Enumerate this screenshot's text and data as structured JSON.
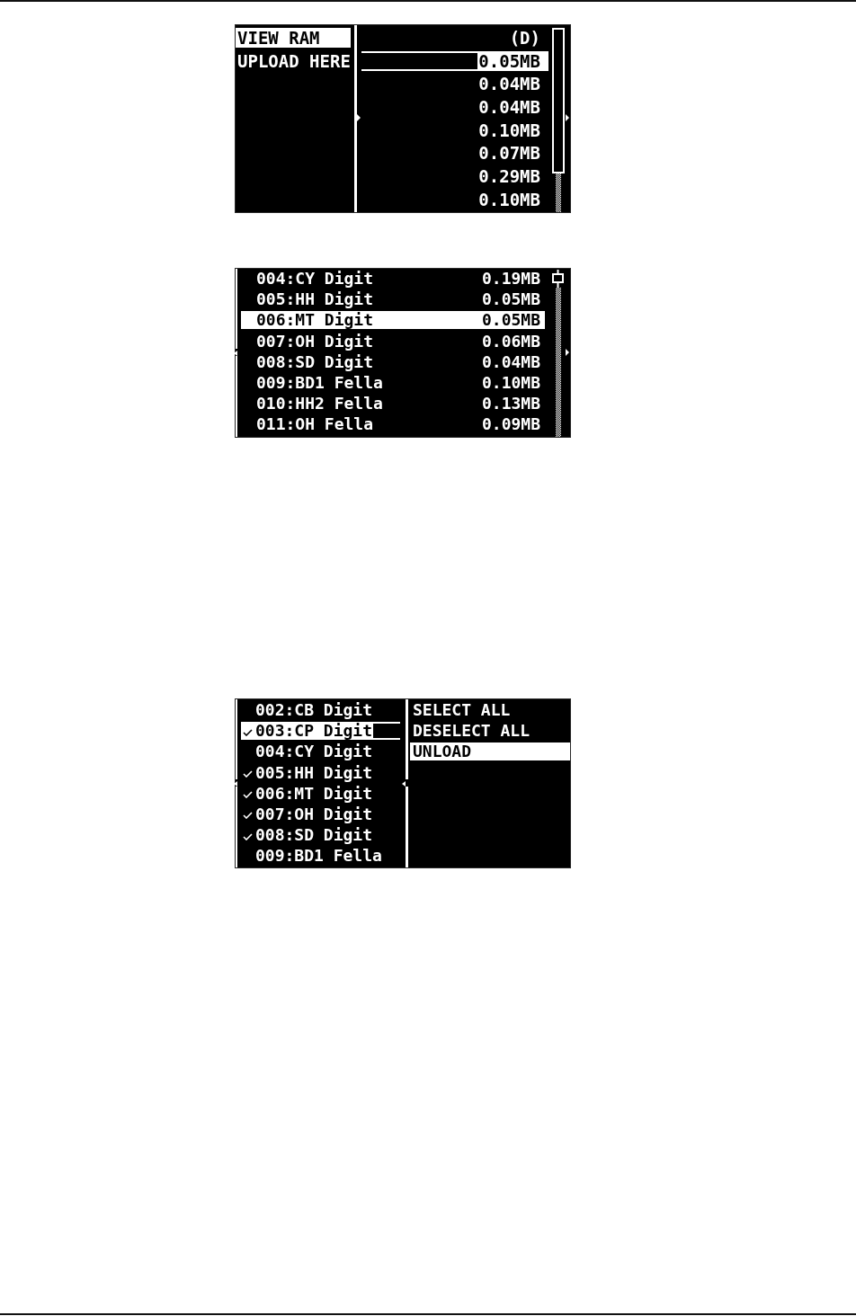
{
  "screens": [
    {
      "kind": "browser",
      "menu": {
        "focused": true,
        "items": [
          {
            "label": "VIEW RAM",
            "selected": true
          },
          {
            "label": "UPLOAD HERE",
            "selected": false
          }
        ]
      },
      "files": {
        "focused": false,
        "items": [
          {
            "text": "(D)",
            "selected": false
          },
          {
            "text": "0.05MB",
            "selected": true
          },
          {
            "text": "0.04MB",
            "selected": false
          },
          {
            "text": "0.04MB",
            "selected": false
          },
          {
            "text": "0.10MB",
            "selected": false
          },
          {
            "text": "0.07MB",
            "selected": false
          },
          {
            "text": "0.29MB",
            "selected": false
          },
          {
            "text": "0.10MB",
            "selected": false
          }
        ]
      }
    },
    {
      "kind": "list",
      "samples": {
        "focused": true,
        "items": [
          {
            "name": "004:CY Digit",
            "size": "0.19MB",
            "selected": false
          },
          {
            "name": "005:HH Digit",
            "size": "0.05MB",
            "selected": false
          },
          {
            "name": "006:MT Digit",
            "size": "0.05MB",
            "selected": true
          },
          {
            "name": "007:OH Digit",
            "size": "0.06MB",
            "selected": false
          },
          {
            "name": "008:SD Digit",
            "size": "0.04MB",
            "selected": false
          },
          {
            "name": "009:BD1 Fella",
            "size": "0.10MB",
            "selected": false
          },
          {
            "name": "010:HH2 Fella",
            "size": "0.13MB",
            "selected": false
          },
          {
            "name": "011:OH Fella",
            "size": "0.09MB",
            "selected": false
          }
        ]
      }
    },
    {
      "kind": "select",
      "check_list": {
        "focused": false,
        "items": [
          {
            "name": "002:CB Digit",
            "checked": false,
            "selected": false
          },
          {
            "name": "003:CP Digit",
            "checked": true,
            "selected": true
          },
          {
            "name": "004:CY Digit",
            "checked": false,
            "selected": false
          },
          {
            "name": "005:HH Digit",
            "checked": true,
            "selected": false
          },
          {
            "name": "006:MT Digit",
            "checked": true,
            "selected": false
          },
          {
            "name": "007:OH Digit",
            "checked": true,
            "selected": false
          },
          {
            "name": "008:SD Digit",
            "checked": true,
            "selected": false
          },
          {
            "name": "009:BD1 Fella",
            "checked": false,
            "selected": false
          }
        ]
      },
      "menu": {
        "focused": true,
        "items": [
          {
            "label": "SELECT ALL",
            "selected": false
          },
          {
            "label": "DESELECT ALL",
            "selected": false
          },
          {
            "label": "UNLOAD",
            "selected": true
          }
        ]
      }
    }
  ]
}
